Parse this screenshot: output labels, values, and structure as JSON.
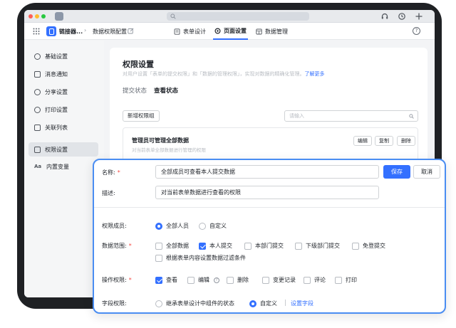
{
  "app": {
    "name": "链接器...",
    "breadcrumb_page": "数据权限配置"
  },
  "top_nav": [
    {
      "label": "表单设计"
    },
    {
      "label": "页面设置"
    },
    {
      "label": "数据管理"
    }
  ],
  "search_bar": {
    "placeholder": ""
  },
  "sidebar": {
    "items": [
      {
        "label": "基础设置",
        "icon": "gear-icon"
      },
      {
        "label": "消息通知",
        "icon": "message-icon"
      },
      {
        "label": "分享设置",
        "icon": "user-share-icon"
      },
      {
        "label": "打印设置",
        "icon": "printer-icon"
      },
      {
        "label": "关联列表",
        "icon": "list-icon"
      },
      {
        "label": "权限设置",
        "icon": "lock-icon"
      },
      {
        "label": "内置变量",
        "icon": "variable-icon"
      }
    ],
    "active_index": 5
  },
  "main": {
    "title": "权限设置",
    "description": "对用户设置「表单的提交权限」和「数据的管理权限」，实现对数据的精确化管理。",
    "learn_more": "了解更多",
    "tabs": [
      {
        "label": "提交状态"
      },
      {
        "label": "查看状态"
      }
    ],
    "new_group_button": "新增权限组",
    "search_placeholder": "请输入",
    "group_card": {
      "title": "管理员可管理全部数据",
      "description": "对当前表单全部数据进行管理的权限",
      "buttons": [
        "编辑",
        "复制",
        "删除"
      ]
    }
  },
  "popup": {
    "name_label": "名称:",
    "name_value": "全部成员可查看本人提交数据",
    "save_button": "保存",
    "cancel_button": "取消",
    "desc_label": "描述:",
    "desc_value": "对当前表单数据进行查看的权限",
    "members_label": "权限成员:",
    "members_options": [
      {
        "label": "全部人员",
        "selected": true
      },
      {
        "label": "自定义",
        "selected": false
      }
    ],
    "scope_label": "数据范围:",
    "scope_options": [
      {
        "label": "全部数据",
        "checked": false
      },
      {
        "label": "本人提交",
        "checked": true
      },
      {
        "label": "本部门提交",
        "checked": false
      },
      {
        "label": "下级部门提交",
        "checked": false
      },
      {
        "label": "免登提交",
        "checked": false
      },
      {
        "label": "根据表单内容设置数据过滤条件",
        "checked": false
      }
    ],
    "ops_label": "操作权限:",
    "ops_options": [
      {
        "label": "查看",
        "checked": true
      },
      {
        "label": "编辑",
        "checked": false
      },
      {
        "label": "删除",
        "checked": false
      },
      {
        "label": "变更记录",
        "checked": false
      },
      {
        "label": "评论",
        "checked": false
      },
      {
        "label": "打印",
        "checked": false
      }
    ],
    "field_label": "字段权限:",
    "field_options": [
      {
        "label": "继承表单设计中组件的状态",
        "selected": false
      },
      {
        "label": "自定义",
        "selected": true
      }
    ],
    "field_link": "设置字段"
  },
  "colors": {
    "accent": "#3370ff",
    "popup_border": "#4a8df2",
    "required": "#f54a45"
  }
}
